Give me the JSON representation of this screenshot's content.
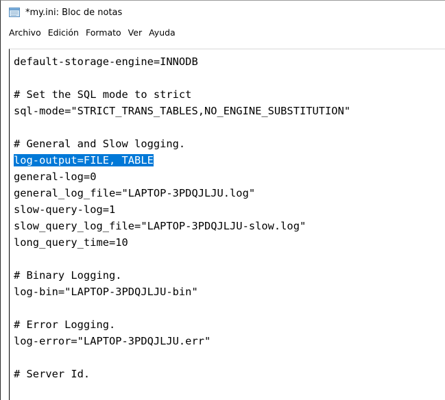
{
  "window": {
    "title": "*my.ini: Bloc de notas",
    "icon": "notepad-icon"
  },
  "menu": {
    "items": [
      "Archivo",
      "Edición",
      "Formato",
      "Ver",
      "Ayuda"
    ]
  },
  "editor": {
    "lines": [
      "default-storage-engine=INNODB",
      "",
      "# Set the SQL mode to strict",
      "sql-mode=\"STRICT_TRANS_TABLES,NO_ENGINE_SUBSTITUTION\"",
      "",
      "# General and Slow logging.",
      "log-output=FILE, TABLE",
      "general-log=0",
      "general_log_file=\"LAPTOP-3PDQJLJU.log\"",
      "slow-query-log=1",
      "slow_query_log_file=\"LAPTOP-3PDQJLJU-slow.log\"",
      "long_query_time=10",
      "",
      "# Binary Logging.",
      "log-bin=\"LAPTOP-3PDQJLJU-bin\"",
      "",
      "# Error Logging.",
      "log-error=\"LAPTOP-3PDQJLJU.err\"",
      "",
      "# Server Id."
    ],
    "selected_line_index": 6
  }
}
